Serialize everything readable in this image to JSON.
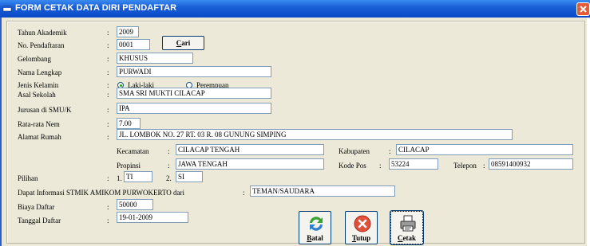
{
  "window": {
    "title": "FORM CETAK DATA DIRI PENDAFTAR"
  },
  "fields": {
    "tahun_akademik": {
      "label": "Tahun Akademik",
      "value": "2009"
    },
    "no_pendaftaran": {
      "label": "No. Pendaftaran",
      "value": "0001"
    },
    "gelombang": {
      "label": "Gelombang",
      "value": "KHUSUS"
    },
    "nama_lengkap": {
      "label": "Nama Lengkap",
      "value": "PURWADI"
    },
    "jenis_kelamin": {
      "label": "Jenis Kelamin",
      "options": [
        "Laki-laki",
        "Perempuan"
      ],
      "selected": "Laki-laki"
    },
    "asal_sekolah": {
      "label": "Asal Sekolah",
      "value": "SMA SRI MUKTI CILACAP"
    },
    "jurusan": {
      "label": "Jurusan di SMU/K",
      "value": "IPA"
    },
    "rata_rata_nem": {
      "label": "Rata-rata Nem",
      "value": "7.00"
    },
    "alamat_rumah": {
      "label": "Alamat Rumah",
      "value": "JL. LOMBOK NO. 27 RT. 03 R. 08 GUNUNG SIMPING"
    },
    "kecamatan": {
      "label": "Kecamatan",
      "value": "CILACAP TENGAH"
    },
    "kabupaten": {
      "label": "Kabupaten",
      "value": "CILACAP"
    },
    "propinsi": {
      "label": "Propinsi",
      "value": "JAWA TENGAH"
    },
    "kode_pos": {
      "label": "Kode Pos",
      "value": "53224"
    },
    "telepon": {
      "label": "Telepon",
      "value": "08591400932"
    },
    "pilihan": {
      "label": "Pilihan",
      "first_num": "1.",
      "first": "TI",
      "second_num": "2.",
      "second": "SI"
    },
    "informasi": {
      "label": "Dapat Informasi STMIK AMIKOM PURWOKERTO dari",
      "value": "TEMAN/SAUDARA"
    },
    "biaya_daftar": {
      "label": "Biaya Daftar",
      "value": "50000"
    },
    "tanggal_daftar": {
      "label": "Tanggal Daftar",
      "value": "19-01-2009"
    }
  },
  "buttons": {
    "cari": {
      "label_first": "C",
      "label_rest": "ari"
    },
    "batal": {
      "label_first": "B",
      "label_rest": "atal"
    },
    "tutup": {
      "label_first": "T",
      "label_rest": "utup"
    },
    "cetak": {
      "label_first": "C",
      "label_rest": "etak"
    }
  },
  "icons": {
    "app": "form-icon",
    "close": "close-icon",
    "batal": "refresh-arrows-icon",
    "tutup": "close-circle-icon",
    "cetak": "printer-icon"
  },
  "colors": {
    "titlebar": "#0a49c8",
    "window_bg": "#ece9d8",
    "close": "#e45b37"
  }
}
